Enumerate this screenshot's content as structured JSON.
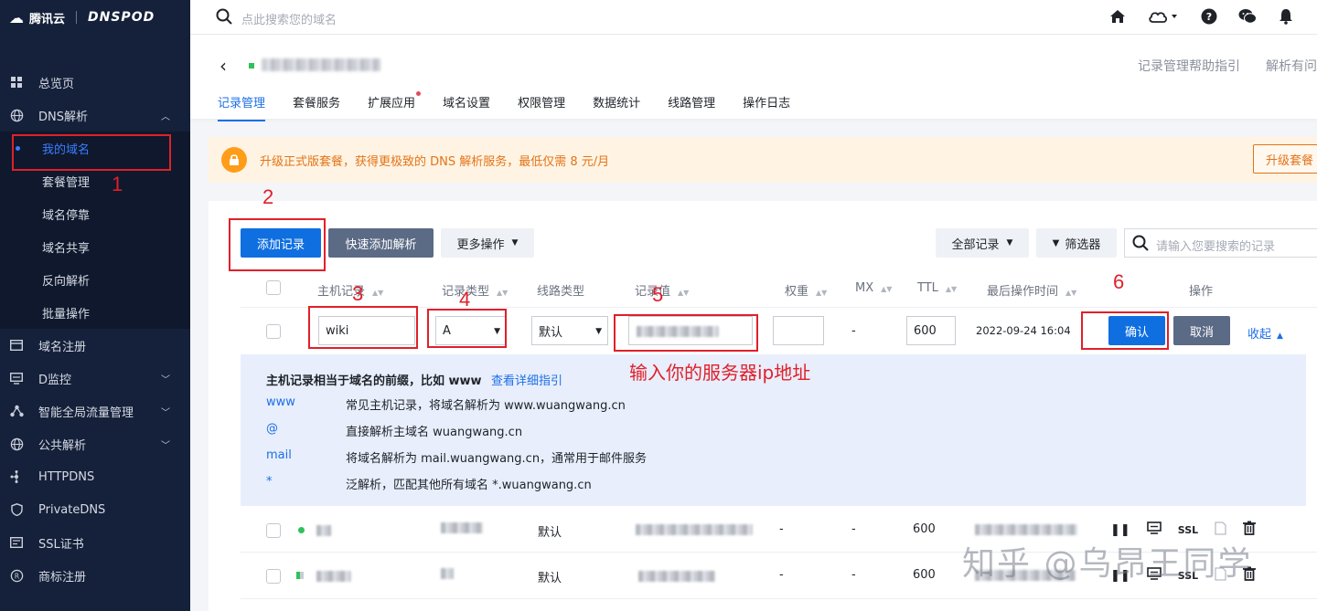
{
  "logo": {
    "brand": "腾讯云",
    "product": "DNSPOD"
  },
  "sidebar": {
    "items": [
      {
        "icon": "grid-icon",
        "label": "总览页"
      },
      {
        "icon": "globe-icon",
        "label": "DNS解析",
        "expanded": true,
        "children": [
          {
            "label": "我的域名",
            "active": true
          },
          {
            "label": "套餐管理"
          },
          {
            "label": "域名停靠"
          },
          {
            "label": "域名共享"
          },
          {
            "label": "反向解析"
          },
          {
            "label": "批量操作"
          }
        ]
      },
      {
        "icon": "card-icon",
        "label": "域名注册"
      },
      {
        "icon": "monitor-icon",
        "label": "D监控",
        "has_children": true
      },
      {
        "icon": "traffic-icon",
        "label": "智能全局流量管理",
        "has_children": true
      },
      {
        "icon": "globe-icon",
        "label": "公共解析",
        "has_children": true
      },
      {
        "icon": "nodes-icon",
        "label": "HTTPDNS"
      },
      {
        "icon": "shield-icon",
        "label": "PrivateDNS"
      },
      {
        "icon": "certificate-icon",
        "label": "SSL证书"
      },
      {
        "icon": "trademark-icon",
        "label": "商标注册"
      }
    ]
  },
  "topbar": {
    "search_placeholder": "点此搜索您的域名"
  },
  "header": {
    "help_links": [
      "记录管理帮助指引",
      "解析有问"
    ],
    "tabs": [
      {
        "label": "记录管理",
        "active": true
      },
      {
        "label": "套餐服务"
      },
      {
        "label": "扩展应用",
        "badge": true
      },
      {
        "label": "域名设置"
      },
      {
        "label": "权限管理"
      },
      {
        "label": "数据统计"
      },
      {
        "label": "线路管理"
      },
      {
        "label": "操作日志"
      }
    ]
  },
  "banner": {
    "text": "升级正式版套餐，获得更极致的 DNS 解析服务，最低仅需 8 元/月",
    "button": "升级套餐"
  },
  "toolbar": {
    "add_record": "添加记录",
    "quick_add": "快速添加解析",
    "more_actions": "更多操作",
    "all_records": "全部记录",
    "filter": "筛选器",
    "search_placeholder": "请输入您要搜索的记录"
  },
  "table": {
    "headers": [
      "主机记录",
      "记录类型",
      "线路类型",
      "记录值",
      "权重",
      "MX",
      "TTL",
      "最后操作时间",
      "操作"
    ],
    "edit_row": {
      "host": "wiki",
      "type": "A",
      "line": "默认",
      "mx": "-",
      "ttl": "600",
      "time": "2022-09-24 16:04",
      "confirm": "确认",
      "cancel": "取消",
      "collapse": "收起"
    },
    "hint": {
      "title": "主机记录相当于域名的前缀，比如 www",
      "link": "查看详细指引",
      "rows": [
        {
          "key": "www",
          "desc": "常见主机记录，将域名解析为 www.wuangwang.cn"
        },
        {
          "key": "@",
          "desc": "直接解析主域名 wuangwang.cn"
        },
        {
          "key": "mail",
          "desc": "将域名解析为 mail.wuangwang.cn，通常用于邮件服务"
        },
        {
          "key": "*",
          "desc": "泛解析，匹配其他所有域名 *.wuangwang.cn"
        }
      ]
    },
    "rows": [
      {
        "line": "默认",
        "weight": "-",
        "mx": "-",
        "ttl": "600",
        "ssl": "SSL"
      },
      {
        "line": "默认",
        "weight": "-",
        "mx": "-",
        "ttl": "600",
        "ssl": "SSL"
      }
    ]
  },
  "annotations": {
    "numbers": [
      "1",
      "2",
      "3",
      "4",
      "5",
      "6"
    ],
    "instruction": "输入你的服务器ip地址",
    "watermark": "知乎 @乌昂王同学"
  },
  "colors": {
    "primary": "#0f6fe0",
    "sidebar_bg": "#15203a",
    "annotation_red": "#e0202a",
    "banner_bg": "#fff4e3"
  }
}
